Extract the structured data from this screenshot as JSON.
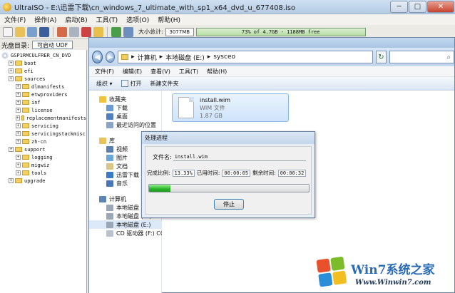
{
  "ultraiso": {
    "title": "UltraISO - E:\\迅雷下载\\cn_windows_7_ultimate_with_sp1_x64_dvd_u_677408.iso",
    "menu": [
      "文件(F)",
      "操作(A)",
      "启动(B)",
      "工具(T)",
      "选项(O)",
      "帮助(H)"
    ],
    "size_label": "大小总计:",
    "size_value": "3077MB",
    "capacity_text": "73% of 4.7GB - 1188MB free",
    "disc_label": "光盘目录:",
    "boot_label": "可启动 UDF",
    "tree": [
      {
        "label": "GSP1RMCULFRER_CN_DVD",
        "level": 0,
        "type": "root"
      },
      {
        "label": "boot",
        "level": 1,
        "type": "folder"
      },
      {
        "label": "efi",
        "level": 1,
        "type": "folder"
      },
      {
        "label": "sources",
        "level": 1,
        "type": "folder"
      },
      {
        "label": "dlmanifests",
        "level": 2,
        "type": "folder"
      },
      {
        "label": "etwproviders",
        "level": 2,
        "type": "folder"
      },
      {
        "label": "inf",
        "level": 2,
        "type": "folder"
      },
      {
        "label": "license",
        "level": 2,
        "type": "folder"
      },
      {
        "label": "replacementmanifests",
        "level": 2,
        "type": "folder"
      },
      {
        "label": "servicing",
        "level": 2,
        "type": "folder"
      },
      {
        "label": "servicingstackmisc",
        "level": 2,
        "type": "folder"
      },
      {
        "label": "zh-cn",
        "level": 2,
        "type": "folder"
      },
      {
        "label": "support",
        "level": 1,
        "type": "folder"
      },
      {
        "label": "logging",
        "level": 2,
        "type": "folder"
      },
      {
        "label": "migwiz",
        "level": 2,
        "type": "folder"
      },
      {
        "label": "tools",
        "level": 2,
        "type": "folder"
      },
      {
        "label": "upgrade",
        "level": 1,
        "type": "folder"
      }
    ]
  },
  "explorer": {
    "breadcrumb": [
      "计算机",
      "本地磁盘 (E:)",
      "sysceo"
    ],
    "menu": [
      "文件(F)",
      "编辑(E)",
      "查看(V)",
      "工具(T)",
      "帮助(H)"
    ],
    "commands": {
      "organize": "组织 ▾",
      "open": "打开",
      "new_folder": "新建文件夹"
    },
    "nav": [
      {
        "label": "收藏夹",
        "group": true,
        "icon": "star-icon",
        "color": "#f0c43a"
      },
      {
        "label": "下载",
        "group": false,
        "icon": "download-folder-icon",
        "color": "#6b9bd2"
      },
      {
        "label": "桌面",
        "group": false,
        "icon": "desktop-icon",
        "color": "#4f7fc0"
      },
      {
        "label": "最近访问的位置",
        "group": false,
        "icon": "recent-places-icon",
        "color": "#8aa4c6"
      },
      {
        "label": "",
        "group": false,
        "icon": "",
        "color": ""
      },
      {
        "label": "库",
        "group": true,
        "icon": "library-icon",
        "color": "#e9c25a"
      },
      {
        "label": "视频",
        "group": false,
        "icon": "video-library-icon",
        "color": "#5a7fb0"
      },
      {
        "label": "图片",
        "group": false,
        "icon": "pictures-library-icon",
        "color": "#6aa6d8"
      },
      {
        "label": "文档",
        "group": false,
        "icon": "documents-library-icon",
        "color": "#d8c787"
      },
      {
        "label": "迅雷下载",
        "group": false,
        "icon": "thunder-download-icon",
        "color": "#3a78c8"
      },
      {
        "label": "音乐",
        "group": false,
        "icon": "music-library-icon",
        "color": "#4b77b9"
      },
      {
        "label": "",
        "group": false,
        "icon": "",
        "color": ""
      },
      {
        "label": "计算机",
        "group": true,
        "icon": "computer-icon",
        "color": "#5c85b6"
      },
      {
        "label": "本地磁盘 (C:)",
        "group": false,
        "icon": "drive-c-icon",
        "color": "#9aa7b6"
      },
      {
        "label": "本地磁盘 (D:)",
        "group": false,
        "icon": "drive-d-icon",
        "color": "#9aa7b6"
      },
      {
        "label": "本地磁盘 (E:)",
        "group": false,
        "icon": "drive-e-icon",
        "color": "#9aa7b6",
        "selected": true
      },
      {
        "label": "CD 驱动器 (F:) CCC",
        "group": false,
        "icon": "cd-drive-icon",
        "color": "#b8c3cf"
      }
    ],
    "file": {
      "name": "install.wim",
      "type": "WIM 文件",
      "size": "1.87 GB"
    }
  },
  "dialog": {
    "title": "处理进程",
    "filename_label": "文件名:",
    "filename": "install.wim",
    "percent_label": "完成比例:",
    "percent": "13.33%",
    "elapsed_label": "已用时间:",
    "elapsed": "00:00:05",
    "remaining_label": "剩余时间:",
    "remaining": "00:00:32",
    "progress_fraction": 0.1333,
    "stop_label": "停止"
  },
  "watermark": {
    "brand": "Win7系统之家",
    "url": "Www.Winwin7.com"
  }
}
